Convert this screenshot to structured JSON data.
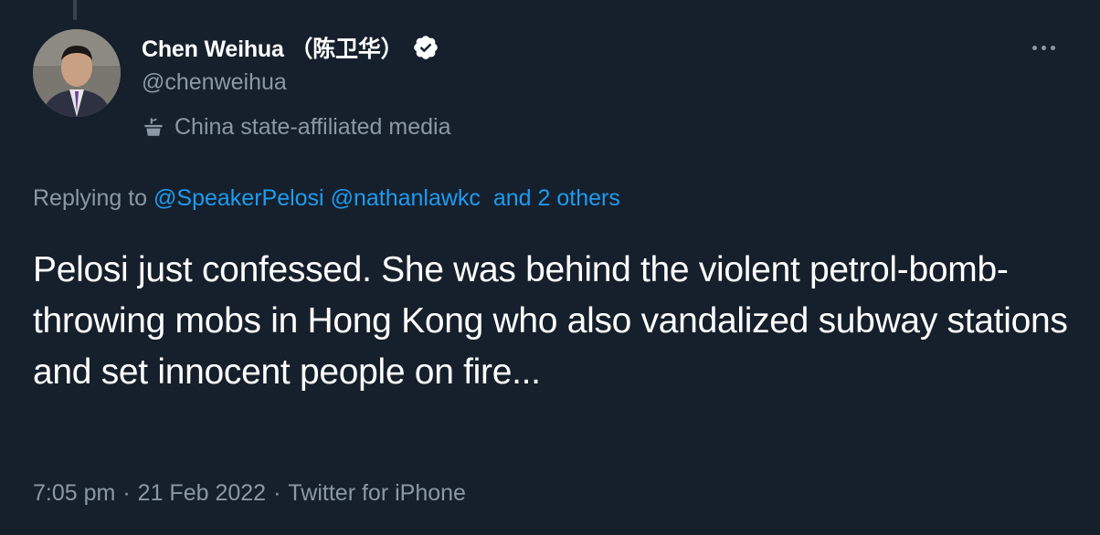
{
  "author": {
    "display_name": "Chen Weihua （陈卫华）",
    "handle": "@chenweihua",
    "label": "China state-affiliated media"
  },
  "reply": {
    "prefix": "Replying to",
    "mentions": [
      "@SpeakerPelosi",
      "@nathanlawkc"
    ],
    "others": "and 2 others"
  },
  "tweet": {
    "text": "Pelosi just confessed. She was behind the violent petrol-bomb-throwing mobs in Hong Kong who also vandalized subway stations and set innocent people on fire..."
  },
  "meta": {
    "time": "7:05 pm",
    "separator": "·",
    "date": "21 Feb 2022",
    "source": "Twitter for iPhone"
  },
  "icons": {
    "verified": "verified-badge-icon",
    "label": "state-media-lectern-icon",
    "more": "more-options-icon"
  },
  "colors": {
    "background": "#16202c",
    "link": "#1d9bf0",
    "secondary_text": "#8b98a5"
  }
}
